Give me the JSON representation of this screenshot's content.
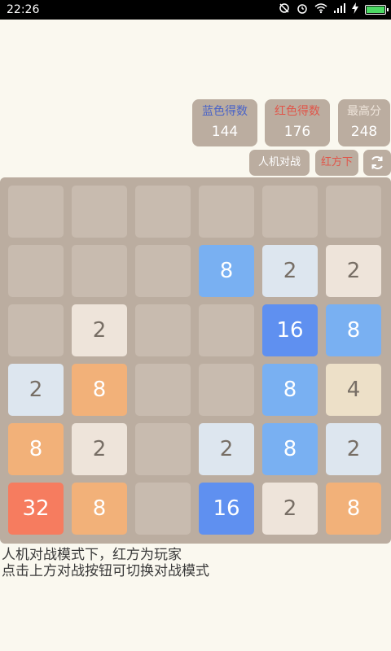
{
  "status_bar": {
    "time": "22:26",
    "icons": [
      "alarm-off-icon",
      "alarm-clock-icon",
      "wifi-icon",
      "signal-icon",
      "charging-icon",
      "battery-icon"
    ]
  },
  "scores": {
    "blue": {
      "label": "蓝色得数",
      "value": "144",
      "color": "#4a63c7"
    },
    "red": {
      "label": "红色得数",
      "value": "176",
      "color": "#e0564a"
    },
    "best": {
      "label": "最高分",
      "value": "248",
      "color": "#eee4da"
    }
  },
  "controls": {
    "mode_label": "人机对战",
    "turn_label": "红方下",
    "turn_color": "#e0564a",
    "refresh_icon": "refresh-icon"
  },
  "board": {
    "rows": 6,
    "cols": 6,
    "cells": [
      [
        null,
        null,
        null,
        null,
        null,
        null
      ],
      [
        null,
        null,
        null,
        {
          "v": "8",
          "side": "blue"
        },
        {
          "v": "2",
          "side": "blue"
        },
        {
          "v": "2",
          "side": "red"
        }
      ],
      [
        null,
        {
          "v": "2",
          "side": "red"
        },
        null,
        null,
        {
          "v": "16",
          "side": "blue"
        },
        {
          "v": "8",
          "side": "blue"
        }
      ],
      [
        {
          "v": "2",
          "side": "blue"
        },
        {
          "v": "8",
          "side": "red"
        },
        null,
        null,
        {
          "v": "8",
          "side": "blue"
        },
        {
          "v": "4",
          "side": "red"
        }
      ],
      [
        {
          "v": "8",
          "side": "red"
        },
        {
          "v": "2",
          "side": "red"
        },
        null,
        {
          "v": "2",
          "side": "blue"
        },
        {
          "v": "8",
          "side": "blue"
        },
        {
          "v": "2",
          "side": "blue"
        }
      ],
      [
        {
          "v": "32",
          "side": "red"
        },
        {
          "v": "8",
          "side": "red"
        },
        null,
        {
          "v": "16",
          "side": "blue"
        },
        {
          "v": "2",
          "side": "red"
        },
        {
          "v": "8",
          "side": "red"
        }
      ]
    ],
    "tile_colors": {
      "red": {
        "2": "#eee4da",
        "4": "#ede0c8",
        "8": "#f2b179",
        "16": "#f59563",
        "32": "#f67c5f"
      },
      "blue": {
        "2": "#dde6ef",
        "4": "#cbd9ec",
        "8": "#79b0f2",
        "16": "#5f90f0",
        "32": "#4a74e0"
      }
    },
    "dark_text_color": "#776e65",
    "light_text_color": "#ffffff"
  },
  "info": {
    "line1": "人机对战模式下，红方为玩家",
    "line2": "点击上方对战按钮可切换对战模式"
  }
}
